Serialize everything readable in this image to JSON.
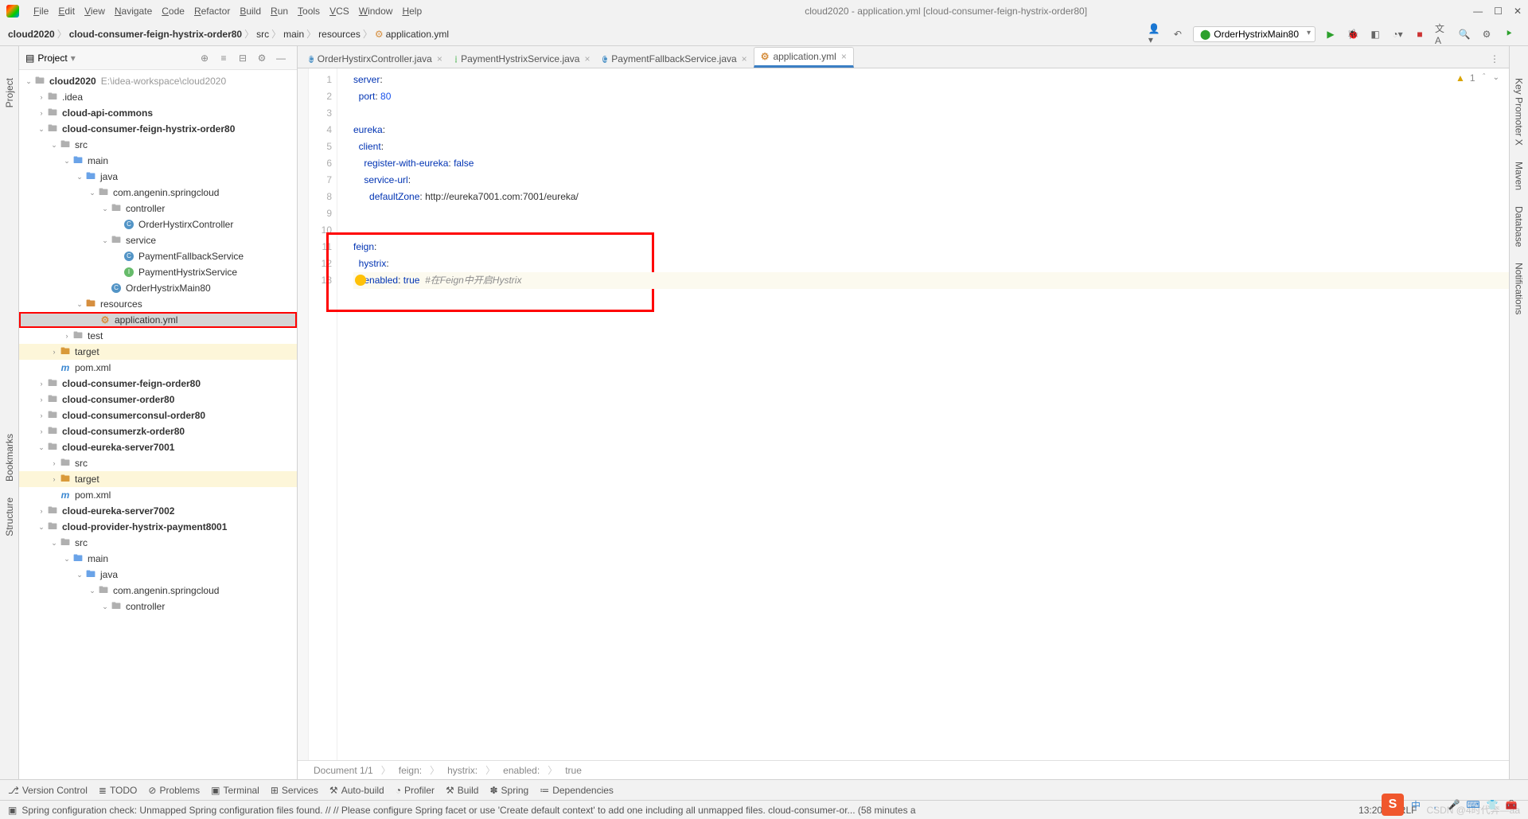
{
  "window": {
    "title": "cloud2020 - application.yml [cloud-consumer-feign-hystrix-order80]",
    "menu": [
      "File",
      "Edit",
      "View",
      "Navigate",
      "Code",
      "Refactor",
      "Build",
      "Run",
      "Tools",
      "VCS",
      "Window",
      "Help"
    ]
  },
  "breadcrumbs": [
    "cloud2020",
    "cloud-consumer-feign-hystrix-order80",
    "src",
    "main",
    "resources",
    "application.yml"
  ],
  "run_config": "OrderHystrixMain80",
  "project_panel": {
    "title": "Project"
  },
  "tree": {
    "root": {
      "name": "cloud2020",
      "hint": "E:\\idea-workspace\\cloud2020"
    },
    "nodes": [
      {
        "d": 1,
        "type": "folder",
        "name": ".idea",
        "arrow": ">"
      },
      {
        "d": 1,
        "type": "module",
        "name": "cloud-api-commons",
        "arrow": ">",
        "bold": true
      },
      {
        "d": 1,
        "type": "module",
        "name": "cloud-consumer-feign-hystrix-order80",
        "arrow": "v",
        "bold": true
      },
      {
        "d": 2,
        "type": "folder",
        "name": "src",
        "arrow": "v"
      },
      {
        "d": 3,
        "type": "folder-blue",
        "name": "main",
        "arrow": "v"
      },
      {
        "d": 4,
        "type": "folder-blue",
        "name": "java",
        "arrow": "v"
      },
      {
        "d": 5,
        "type": "pkg",
        "name": "com.angenin.springcloud",
        "arrow": "v"
      },
      {
        "d": 6,
        "type": "pkg",
        "name": "controller",
        "arrow": "v"
      },
      {
        "d": 7,
        "type": "class",
        "name": "OrderHystirxController"
      },
      {
        "d": 6,
        "type": "pkg",
        "name": "service",
        "arrow": "v"
      },
      {
        "d": 7,
        "type": "class",
        "name": "PaymentFallbackService"
      },
      {
        "d": 7,
        "type": "iface",
        "name": "PaymentHystrixService"
      },
      {
        "d": 6,
        "type": "class-run",
        "name": "OrderHystrixMain80"
      },
      {
        "d": 4,
        "type": "folder-res",
        "name": "resources",
        "arrow": "v"
      },
      {
        "d": 5,
        "type": "yml",
        "name": "application.yml",
        "selected": true,
        "redbox": true
      },
      {
        "d": 3,
        "type": "folder",
        "name": "test",
        "arrow": ">"
      },
      {
        "d": 2,
        "type": "folder-orange",
        "name": "target",
        "arrow": ">",
        "hi": true
      },
      {
        "d": 2,
        "type": "xml",
        "name": "pom.xml"
      },
      {
        "d": 1,
        "type": "module",
        "name": "cloud-consumer-feign-order80",
        "arrow": ">",
        "bold": true
      },
      {
        "d": 1,
        "type": "module",
        "name": "cloud-consumer-order80",
        "arrow": ">",
        "bold": true
      },
      {
        "d": 1,
        "type": "module",
        "name": "cloud-consumerconsul-order80",
        "arrow": ">",
        "bold": true
      },
      {
        "d": 1,
        "type": "module",
        "name": "cloud-consumerzk-order80",
        "arrow": ">",
        "bold": true
      },
      {
        "d": 1,
        "type": "module",
        "name": "cloud-eureka-server7001",
        "arrow": "v",
        "bold": true
      },
      {
        "d": 2,
        "type": "folder",
        "name": "src",
        "arrow": ">"
      },
      {
        "d": 2,
        "type": "folder-orange",
        "name": "target",
        "arrow": ">",
        "hi": true
      },
      {
        "d": 2,
        "type": "xml",
        "name": "pom.xml"
      },
      {
        "d": 1,
        "type": "module",
        "name": "cloud-eureka-server7002",
        "arrow": ">",
        "bold": true
      },
      {
        "d": 1,
        "type": "module",
        "name": "cloud-provider-hystrix-payment8001",
        "arrow": "v",
        "bold": true
      },
      {
        "d": 2,
        "type": "folder",
        "name": "src",
        "arrow": "v"
      },
      {
        "d": 3,
        "type": "folder-blue",
        "name": "main",
        "arrow": "v"
      },
      {
        "d": 4,
        "type": "folder-blue",
        "name": "java",
        "arrow": "v"
      },
      {
        "d": 5,
        "type": "pkg",
        "name": "com.angenin.springcloud",
        "arrow": "v"
      },
      {
        "d": 6,
        "type": "pkg",
        "name": "controller",
        "arrow": "v"
      }
    ]
  },
  "tabs": [
    {
      "icon": "class",
      "name": "OrderHystirxController.java"
    },
    {
      "icon": "iface",
      "name": "PaymentHystrixService.java"
    },
    {
      "icon": "class",
      "name": "PaymentFallbackService.java"
    },
    {
      "icon": "yml",
      "name": "application.yml",
      "active": true
    }
  ],
  "warning": {
    "count": "1",
    "label": "⚠"
  },
  "code_lines": [
    {
      "n": 1,
      "html": "<span class='key'>server</span>:"
    },
    {
      "n": 2,
      "html": "  <span class='key'>port</span>: <span class='num'>80</span>"
    },
    {
      "n": 3,
      "html": ""
    },
    {
      "n": 4,
      "html": "<span class='key'>eureka</span>:"
    },
    {
      "n": 5,
      "html": "  <span class='key'>client</span>:"
    },
    {
      "n": 6,
      "html": "    <span class='key'>register-with-eureka</span>: <span class='key'>false</span>"
    },
    {
      "n": 7,
      "html": "    <span class='key'>service-url</span>:"
    },
    {
      "n": 8,
      "html": "      <span class='key'>defaultZone</span>: <span class='url'>http://eureka7001.com:7001/eureka/</span>"
    },
    {
      "n": 9,
      "html": ""
    },
    {
      "n": 10,
      "html": ""
    },
    {
      "n": 11,
      "html": "<span class='key'>feign</span>:"
    },
    {
      "n": 12,
      "html": "  <span class='key'>hystrix</span>:"
    },
    {
      "n": 13,
      "html": "    <span class='key'>enabled</span>: <span class='key'>true</span>  <span class='comment'>#在Feign中开启Hystrix</span>",
      "current": true,
      "bulb": true
    }
  ],
  "editor_crumb": [
    "Document 1/1",
    "feign:",
    "hystrix:",
    "enabled:",
    "true"
  ],
  "bottom_tools": [
    "Version Control",
    "TODO",
    "Problems",
    "Terminal",
    "Services",
    "Auto-build",
    "Profiler",
    "Build",
    "Spring",
    "Dependencies"
  ],
  "status": {
    "msg": "Spring configuration check: Unmapped Spring configuration files found. // // Please configure Spring facet or use 'Create default context' to add one including all unmapped files. cloud-consumer-or... (58 minutes a",
    "time": "13:20",
    "line_sep": "CRLF",
    "enc_tail": "CSDN @4时代奔—aa"
  },
  "right_tabs": [
    "Key Promoter X",
    "Maven",
    "Database",
    "Notifications"
  ],
  "left_tabs": [
    "Project",
    "Bookmarks",
    "Structure"
  ]
}
